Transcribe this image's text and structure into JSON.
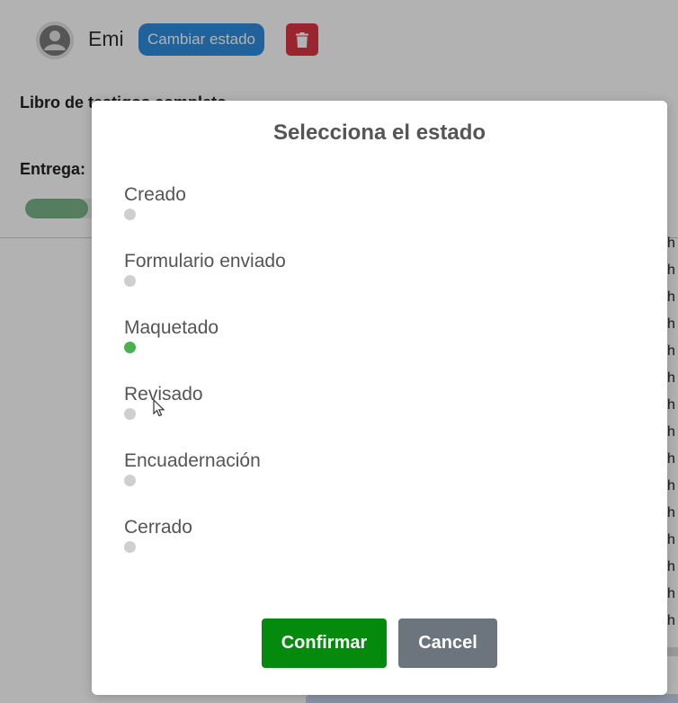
{
  "header": {
    "user_name": "Emi",
    "change_state_label": "Cambiar estado",
    "delete_icon": "trash-icon",
    "avatar_icon": "user-avatar-icon"
  },
  "book": {
    "title": "Libro de testigos completo",
    "delivery_label": "Entrega:",
    "progress_fraction": 0.22
  },
  "background_list": {
    "item_text": "h"
  },
  "modal": {
    "title": "Selecciona el estado",
    "states": [
      {
        "label": "Creado",
        "active": false
      },
      {
        "label": "Formulario enviado",
        "active": false
      },
      {
        "label": "Maquetado",
        "active": true
      },
      {
        "label": "Revisado",
        "active": false
      },
      {
        "label": "Encuadernación",
        "active": false
      },
      {
        "label": "Cerrado",
        "active": false
      }
    ],
    "confirm_label": "Confirmar",
    "cancel_label": "Cancel"
  },
  "colors": {
    "primary": "#2f8fe0",
    "danger": "#dc3545",
    "confirm": "#048a0c",
    "cancel": "#6c757d",
    "active_dot": "#4cb050",
    "inactive_dot": "#cfcfcf"
  }
}
